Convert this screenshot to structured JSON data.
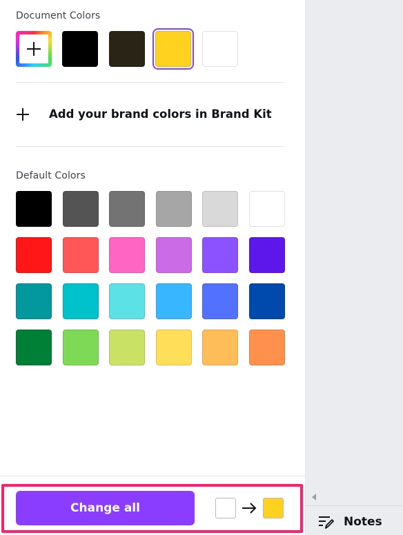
{
  "document_colors": {
    "title": "Document Colors",
    "add_color_icon": "plus-icon",
    "swatches": [
      {
        "color": "#000000",
        "selected": false
      },
      {
        "color": "#2a2416",
        "selected": false
      },
      {
        "color": "#ffd21f",
        "selected": true
      },
      {
        "color": "#ffffff",
        "selected": false
      }
    ]
  },
  "brand_kit": {
    "label": "Add your brand colors in Brand Kit",
    "icon": "plus-icon"
  },
  "default_colors": {
    "title": "Default Colors",
    "rows": [
      [
        "#000000",
        "#545454",
        "#737373",
        "#a6a6a6",
        "#d9d9d9",
        "#ffffff"
      ],
      [
        "#ff1616",
        "#ff5757",
        "#ff66c4",
        "#cb6ce6",
        "#8c52ff",
        "#5e17eb"
      ],
      [
        "#03989e",
        "#00c2cb",
        "#5ce1e6",
        "#38b6ff",
        "#5271ff",
        "#004aad"
      ],
      [
        "#008037",
        "#7ed957",
        "#c9e265",
        "#ffde59",
        "#ffbd59",
        "#ff914d"
      ]
    ]
  },
  "footer": {
    "change_all_label": "Change all",
    "from_color": "#ffffff",
    "to_color": "#ffd21f",
    "arrow_icon": "arrow-right-icon"
  },
  "side": {
    "notes_label": "Notes",
    "notes_icon": "notes-icon",
    "scroll_icon": "triangle-left-icon"
  },
  "accent_color": "#8b3dff",
  "highlight_color": "#ff1f6c"
}
